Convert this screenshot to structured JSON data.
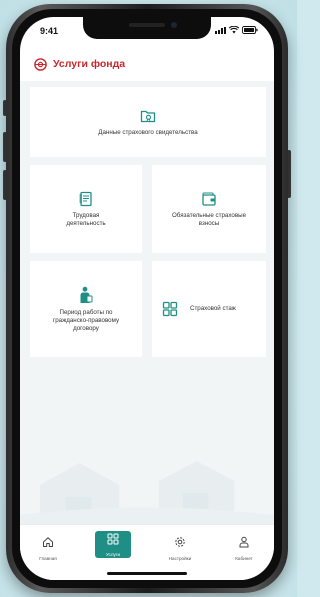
{
  "status": {
    "time": "9:41"
  },
  "header": {
    "title": "Услуги фонда",
    "logo_icon": "fund-logo-icon"
  },
  "services": [
    {
      "label": "Данные страхового свидетельства",
      "icon": "certificate-folder-icon"
    },
    {
      "label": "Трудовая деятельность",
      "icon": "work-document-icon"
    },
    {
      "label": "Обязательные страховые взносы",
      "icon": "wallet-icon"
    },
    {
      "label": "Период работы по гражданско-правовому договору",
      "icon": "worker-person-icon"
    },
    {
      "label": "Страховой стаж",
      "icon": "grid-calculator-icon"
    }
  ],
  "tabbar": {
    "items": [
      {
        "label": "Главная",
        "icon": "home-icon"
      },
      {
        "label": "Услуги",
        "icon": "services-grid-icon"
      },
      {
        "label": "Настройки",
        "icon": "gear-icon"
      },
      {
        "label": "Кабинет",
        "icon": "user-icon"
      }
    ],
    "active_index": 1
  },
  "colors": {
    "accent": "#1f8f85",
    "brand": "#c8282d"
  }
}
